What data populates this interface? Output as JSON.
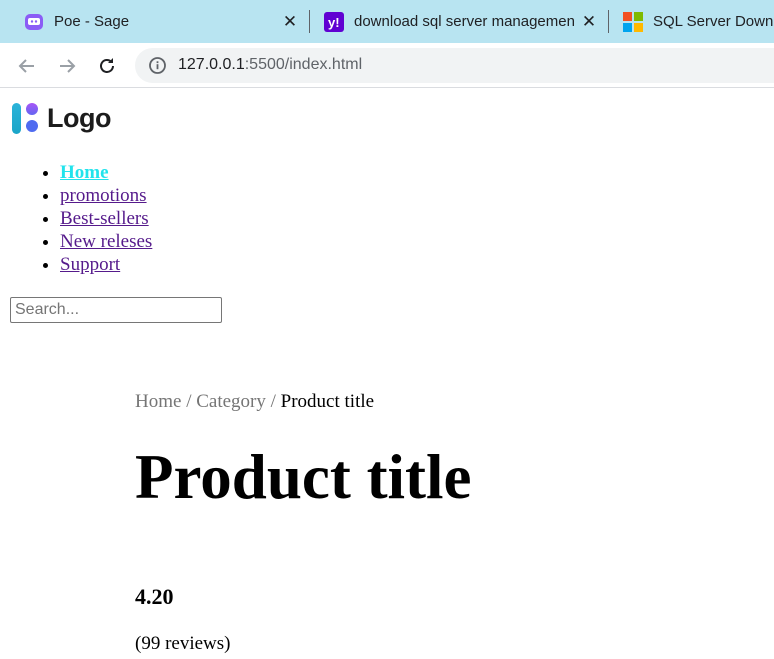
{
  "browser": {
    "tabs": [
      {
        "title": "Poe - Sage",
        "icon": "poe-icon"
      },
      {
        "title": "download sql server management",
        "icon": "yahoo-icon"
      },
      {
        "title": "SQL Server Downlo",
        "icon": "microsoft-icon"
      }
    ],
    "address": {
      "host": "127.0.0.1",
      "path": ":5500/index.html"
    }
  },
  "header": {
    "logo_text": "Logo",
    "nav": [
      {
        "label": "Home",
        "active": true
      },
      {
        "label": "promotions"
      },
      {
        "label": "Best-sellers"
      },
      {
        "label": "New releses"
      },
      {
        "label": "Support"
      }
    ],
    "search": {
      "placeholder": "Search...",
      "value": ""
    }
  },
  "product": {
    "breadcrumb": {
      "home": "Home",
      "category": "Category",
      "current": "Product title",
      "separator": "/"
    },
    "title": "Product title",
    "rating": "4.20",
    "reviews": "(99 reviews)"
  },
  "colors": {
    "tabstrip": "#b8e4f1",
    "nav_link": "#551a8b",
    "nav_active": "#21e3ec",
    "breadcrumb_link": "#757575"
  }
}
